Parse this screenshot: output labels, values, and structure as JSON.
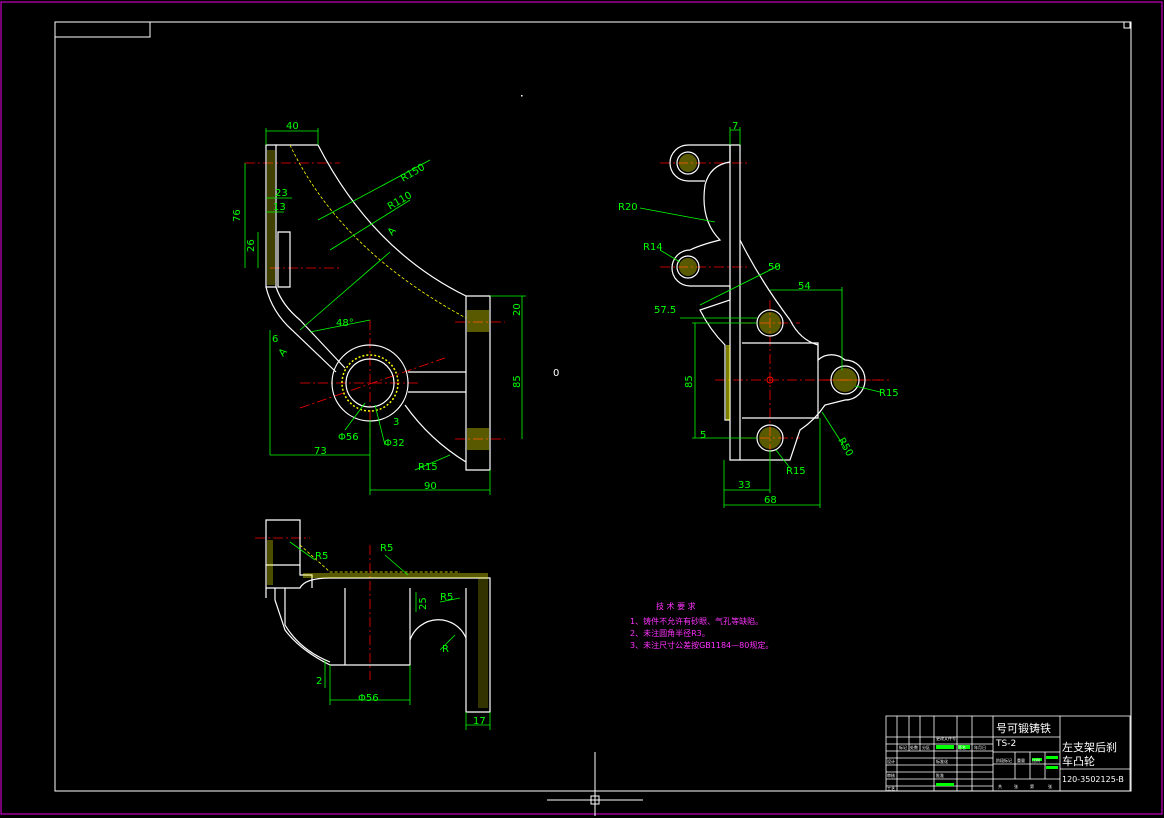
{
  "dimensions": {
    "front": {
      "d40": "40",
      "d76": "76",
      "d26": "26",
      "d23": "23",
      "d13": "13",
      "r150": "R150",
      "r110": "R110",
      "a1": "A",
      "a2": "A",
      "ang48": "48°",
      "d6": "6",
      "d73": "73",
      "phi56": "Φ56",
      "phi32": "Φ32",
      "d3": "3",
      "r15": "R15",
      "d90": "90",
      "d20": "20",
      "d85": "85"
    },
    "side": {
      "d7": "7",
      "r20": "R20",
      "r14": "R14",
      "d50": "50",
      "d54": "54",
      "d57_5": "57.5",
      "d85": "85",
      "d5": "5",
      "r15a": "R15",
      "r50": "R50",
      "r15b": "R15",
      "d33": "33",
      "d68": "68"
    },
    "top": {
      "r5a": "R5",
      "r5b": "R5",
      "r5c": "R5",
      "d25": "25",
      "r": "R",
      "d2": "2",
      "phi56": "Φ56",
      "d17": "17"
    },
    "center_mark": "0"
  },
  "notes": {
    "title": "技 术 要 求",
    "items": [
      "1、铸件不允许有砂眼、气孔等缺陷。",
      "2、未注圆角半径R3。",
      "3、未注尺寸公差按GB1184—80规定。"
    ]
  },
  "title_block": {
    "material": "号可锻铸铁",
    "material2": "TS-2",
    "part_name": "左支架后刹",
    "part_name2": "车凸轮",
    "drawing_no": "120-3502125-B",
    "small": [
      "标记",
      "处数",
      "分区",
      "更改文件号",
      "签名",
      "年月日"
    ],
    "row_labels": [
      "设计",
      "审核",
      "工艺",
      "标准化",
      "批准"
    ],
    "scale_row": [
      "阶段标记",
      "重量",
      "比例"
    ],
    "sheet_row": [
      "共",
      "张",
      "第",
      "张"
    ]
  },
  "colors": {
    "green": "#00ff00",
    "yellow": "#ffff00",
    "red": "#ff0000",
    "white": "#ffffff",
    "magenta": "#ff33ff",
    "frame": "#c000c0"
  }
}
